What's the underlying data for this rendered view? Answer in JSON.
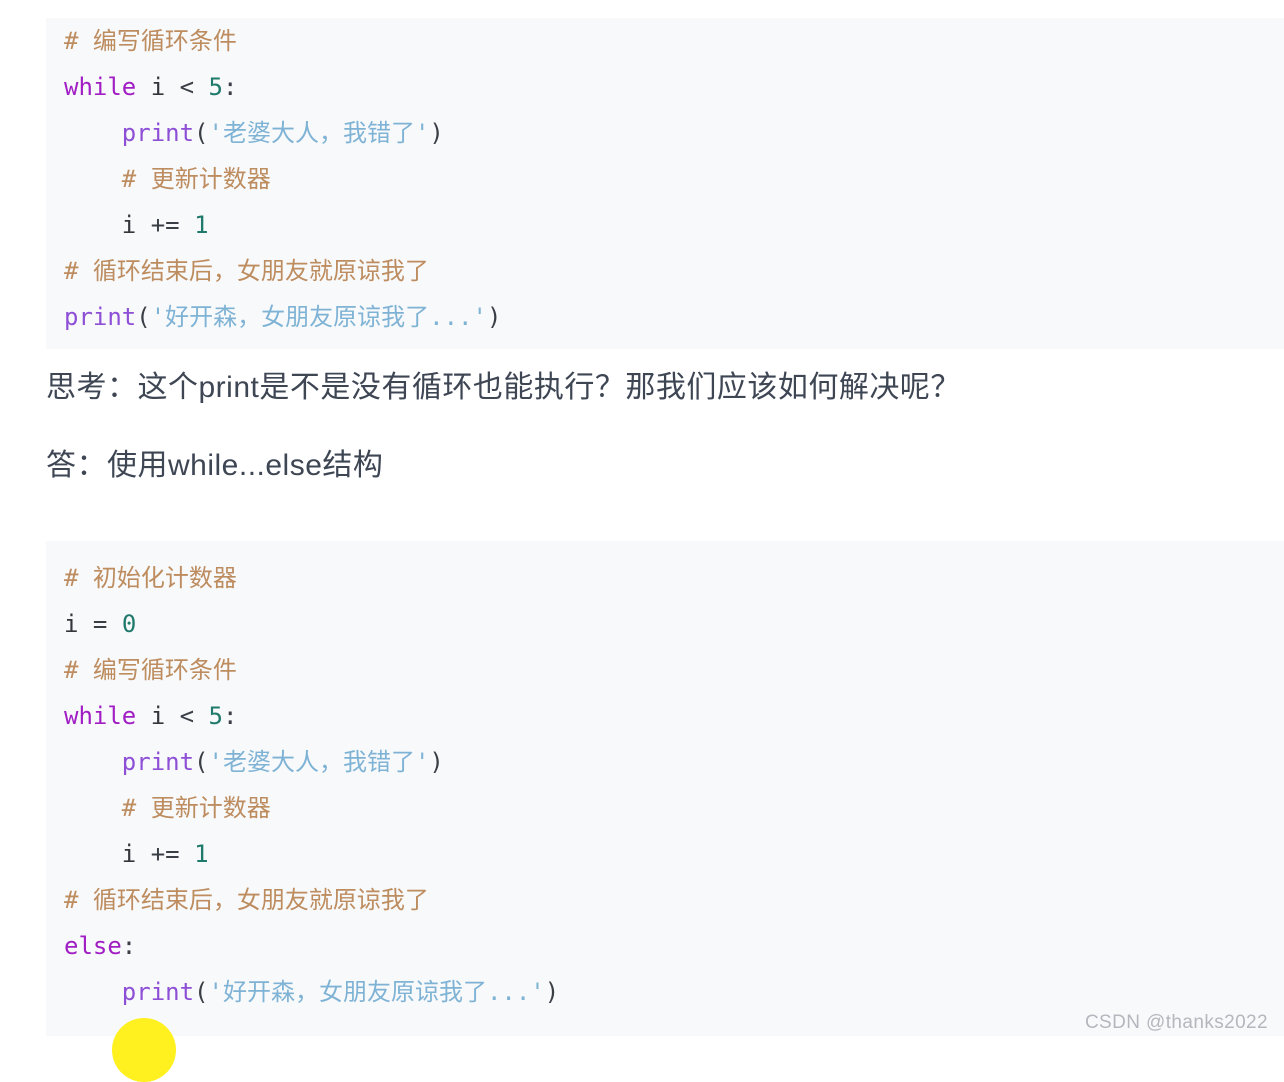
{
  "colors": {
    "page_background": "#ffffff",
    "code_background": "#f8f9fb",
    "comment": "#bd8c5f",
    "keyword": "#a11ec4",
    "function_name": "#8d4fd6",
    "string": "#7fb3d5",
    "number": "#1f7a6b",
    "plain_text": "#33363b",
    "prose_text": "#3e4654",
    "highlight_circle": "#fff01f",
    "watermark": "#b4b7bd"
  },
  "code_block_1": {
    "language": "python",
    "lines": [
      [
        {
          "t": "comment",
          "v": "# 编写循环条件"
        }
      ],
      [
        {
          "t": "keyword",
          "v": "while"
        },
        {
          "t": "plain",
          "v": " i "
        },
        {
          "t": "punct",
          "v": "<"
        },
        {
          "t": "plain",
          "v": " "
        },
        {
          "t": "number",
          "v": "5"
        },
        {
          "t": "punct",
          "v": ":"
        }
      ],
      [
        {
          "t": "plain",
          "v": "    "
        },
        {
          "t": "name",
          "v": "print"
        },
        {
          "t": "punct",
          "v": "("
        },
        {
          "t": "string",
          "v": "'老婆大人，我错了'"
        },
        {
          "t": "punct",
          "v": ")"
        }
      ],
      [
        {
          "t": "plain",
          "v": "    "
        },
        {
          "t": "comment",
          "v": "# 更新计数器"
        }
      ],
      [
        {
          "t": "plain",
          "v": "    i "
        },
        {
          "t": "punct",
          "v": "+="
        },
        {
          "t": "plain",
          "v": " "
        },
        {
          "t": "number",
          "v": "1"
        }
      ],
      [
        {
          "t": "comment",
          "v": "# 循环结束后，女朋友就原谅我了"
        }
      ],
      [
        {
          "t": "name",
          "v": "print"
        },
        {
          "t": "punct",
          "v": "("
        },
        {
          "t": "string",
          "v": "'好开森，女朋友原谅我了...'"
        },
        {
          "t": "punct",
          "v": ")"
        }
      ]
    ]
  },
  "prose": {
    "question": "思考：这个print是不是没有循环也能执行？那我们应该如何解决呢？",
    "answer": "答：使用while...else结构"
  },
  "code_block_2": {
    "language": "python",
    "lines": [
      [
        {
          "t": "comment",
          "v": "# 初始化计数器"
        }
      ],
      [
        {
          "t": "plain",
          "v": "i "
        },
        {
          "t": "punct",
          "v": "="
        },
        {
          "t": "plain",
          "v": " "
        },
        {
          "t": "number",
          "v": "0"
        }
      ],
      [
        {
          "t": "comment",
          "v": "# 编写循环条件"
        }
      ],
      [
        {
          "t": "keyword",
          "v": "while"
        },
        {
          "t": "plain",
          "v": " i "
        },
        {
          "t": "punct",
          "v": "<"
        },
        {
          "t": "plain",
          "v": " "
        },
        {
          "t": "number",
          "v": "5"
        },
        {
          "t": "punct",
          "v": ":"
        }
      ],
      [
        {
          "t": "plain",
          "v": "    "
        },
        {
          "t": "name",
          "v": "print"
        },
        {
          "t": "punct",
          "v": "("
        },
        {
          "t": "string",
          "v": "'老婆大人，我错了'"
        },
        {
          "t": "punct",
          "v": ")"
        }
      ],
      [
        {
          "t": "plain",
          "v": "    "
        },
        {
          "t": "comment",
          "v": "# 更新计数器"
        }
      ],
      [
        {
          "t": "plain",
          "v": "    i "
        },
        {
          "t": "punct",
          "v": "+="
        },
        {
          "t": "plain",
          "v": " "
        },
        {
          "t": "number",
          "v": "1"
        }
      ],
      [
        {
          "t": "comment",
          "v": "# 循环结束后，女朋友就原谅我了"
        }
      ],
      [
        {
          "t": "keyword",
          "v": "else"
        },
        {
          "t": "punct",
          "v": ":"
        }
      ],
      [
        {
          "t": "plain",
          "v": "    "
        },
        {
          "t": "name",
          "v": "print"
        },
        {
          "t": "punct",
          "v": "("
        },
        {
          "t": "string",
          "v": "'好开森，女朋友原谅我了...'"
        },
        {
          "t": "punct",
          "v": ")"
        }
      ]
    ]
  },
  "watermark": {
    "text": "CSDN @thanks2022"
  },
  "annotation": {
    "highlight_circle_shape": "circle"
  }
}
